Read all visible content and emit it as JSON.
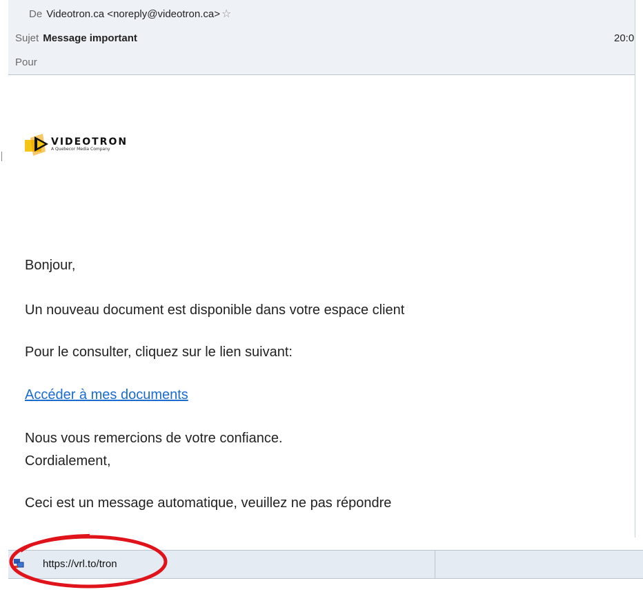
{
  "header": {
    "from_label": "De",
    "from_value": "Videotron.ca <noreply@videotron.ca>",
    "subject_label": "Sujet",
    "subject_value": "Message important",
    "to_label": "Pour",
    "time": "20:0"
  },
  "logo": {
    "brand": "VIDEOTRON",
    "tagline": "A Quebecor Media Company"
  },
  "message": {
    "greeting": "Bonjour,",
    "line1": "Un nouveau document est disponible dans votre espace client",
    "line2": "Pour le consulter, cliquez sur le lien suivant:",
    "link_text": "Accéder à mes documents",
    "thanks": "Nous vous remercions de votre confiance.",
    "closing": "Cordialement,",
    "auto_notice": "Ceci est un message automatique, veuillez ne pas répondre"
  },
  "statusbar": {
    "url": "https://vrl.to/tron"
  },
  "colors": {
    "link": "#1a6bd0",
    "header_bg": "#eef2f7",
    "statusbar_bg": "#e4ebf3",
    "annotation_circle": "#e0121a",
    "logo_yellow": "#f5c518"
  }
}
